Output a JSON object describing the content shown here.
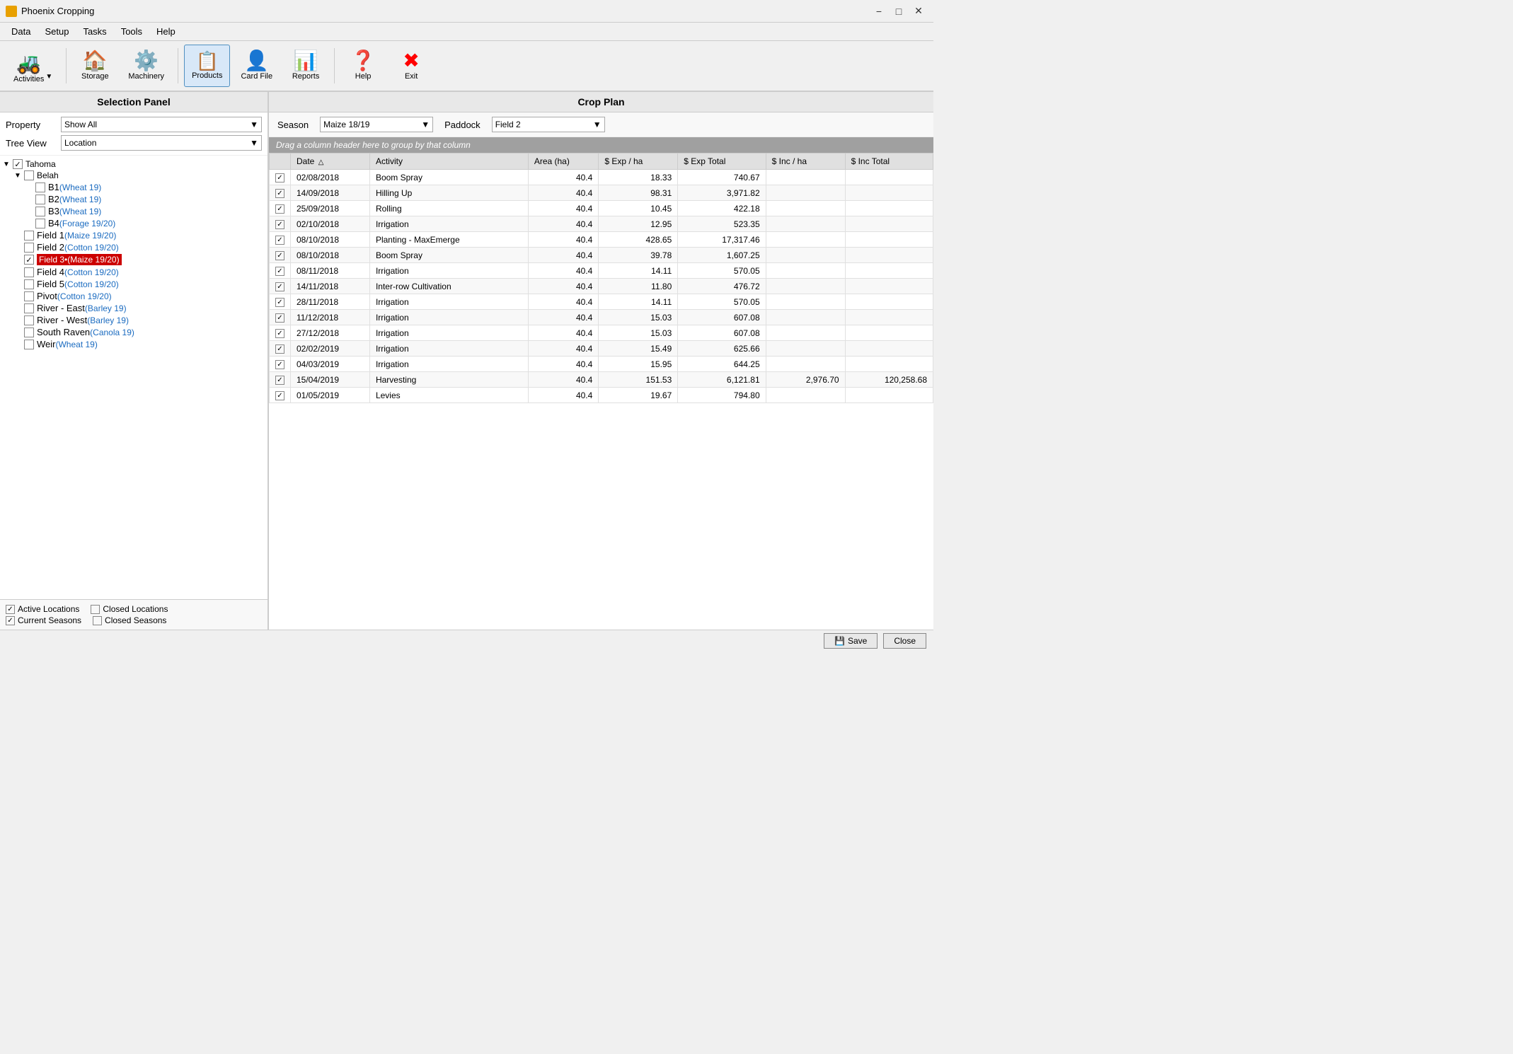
{
  "titleBar": {
    "title": "Phoenix Cropping",
    "icon": "🌾",
    "minimize": "−",
    "maximize": "□",
    "close": "✕"
  },
  "menuBar": {
    "items": [
      "Data",
      "Setup",
      "Tasks",
      "Tools",
      "Help"
    ]
  },
  "toolbar": {
    "buttons": [
      {
        "id": "activities",
        "icon": "🚜",
        "label": "Activities",
        "active": false,
        "hasArrow": true
      },
      {
        "id": "storage",
        "icon": "🏠",
        "label": "Storage",
        "active": false,
        "hasArrow": false
      },
      {
        "id": "machinery",
        "icon": "⚙️",
        "label": "Machinery",
        "active": false,
        "hasArrow": false
      },
      {
        "id": "products",
        "icon": "📋",
        "label": "Products",
        "active": true,
        "hasArrow": false
      },
      {
        "id": "cardfile",
        "icon": "👤",
        "label": "Card File",
        "active": false,
        "hasArrow": false
      },
      {
        "id": "reports",
        "icon": "📊",
        "label": "Reports",
        "active": false,
        "hasArrow": false
      },
      {
        "id": "help",
        "icon": "❓",
        "label": "Help",
        "active": false,
        "hasArrow": false
      },
      {
        "id": "exit",
        "icon": "✖",
        "label": "Exit",
        "active": false,
        "hasArrow": false,
        "iconColor": "red"
      }
    ]
  },
  "leftPanel": {
    "header": "Selection Panel",
    "propertyLabel": "Property",
    "propertyValue": "Show All",
    "treeViewLabel": "Tree View",
    "treeViewValue": "Location",
    "tree": [
      {
        "indent": 0,
        "expand": "▼",
        "checked": true,
        "label": "Tahoma",
        "blue": false,
        "highlight": false
      },
      {
        "indent": 1,
        "expand": "▼",
        "checked": false,
        "label": "Belah",
        "blue": false,
        "highlight": false
      },
      {
        "indent": 2,
        "expand": "",
        "checked": false,
        "label": "B1",
        "labelSuffix": "(Wheat 19)",
        "blue": true,
        "highlight": false
      },
      {
        "indent": 2,
        "expand": "",
        "checked": false,
        "label": "B2",
        "labelSuffix": "(Wheat 19)",
        "blue": true,
        "highlight": false
      },
      {
        "indent": 2,
        "expand": "",
        "checked": false,
        "label": "B3",
        "labelSuffix": "(Wheat 19)",
        "blue": true,
        "highlight": false
      },
      {
        "indent": 2,
        "expand": "",
        "checked": false,
        "label": "B4",
        "labelSuffix": "(Forage 19/20)",
        "blue": true,
        "highlight": false
      },
      {
        "indent": 1,
        "expand": "",
        "checked": false,
        "label": "Field 1",
        "labelSuffix": "(Maize 19/20)",
        "blue": true,
        "highlight": false
      },
      {
        "indent": 1,
        "expand": "",
        "checked": false,
        "label": "Field 2",
        "labelSuffix": "(Cotton 19/20)",
        "blue": true,
        "highlight": false
      },
      {
        "indent": 1,
        "expand": "",
        "checked": true,
        "label": "Field 3•",
        "labelSuffix": "(Maize 19/20)",
        "blue": false,
        "highlight": true
      },
      {
        "indent": 1,
        "expand": "",
        "checked": false,
        "label": "Field 4",
        "labelSuffix": "(Cotton 19/20)",
        "blue": true,
        "highlight": false
      },
      {
        "indent": 1,
        "expand": "",
        "checked": false,
        "label": "Field 5",
        "labelSuffix": "(Cotton 19/20)",
        "blue": true,
        "highlight": false
      },
      {
        "indent": 1,
        "expand": "",
        "checked": false,
        "label": "Pivot",
        "labelSuffix": "(Cotton 19/20)",
        "blue": true,
        "highlight": false
      },
      {
        "indent": 1,
        "expand": "",
        "checked": false,
        "label": "River - East",
        "labelSuffix": "(Barley 19)",
        "blue": true,
        "highlight": false
      },
      {
        "indent": 1,
        "expand": "",
        "checked": false,
        "label": "River - West",
        "labelSuffix": "(Barley 19)",
        "blue": true,
        "highlight": false
      },
      {
        "indent": 1,
        "expand": "",
        "checked": false,
        "label": "South Raven",
        "labelSuffix": "(Canola 19)",
        "blue": true,
        "highlight": false
      },
      {
        "indent": 1,
        "expand": "",
        "checked": false,
        "label": "Weir",
        "labelSuffix": "(Wheat 19)",
        "blue": true,
        "highlight": false
      }
    ],
    "bottomChecks": [
      {
        "id": "active-locations",
        "label": "Active Locations",
        "checked": true
      },
      {
        "id": "closed-locations",
        "label": "Closed Locations",
        "checked": false
      },
      {
        "id": "current-seasons",
        "label": "Current Seasons",
        "checked": true
      },
      {
        "id": "closed-seasons",
        "label": "Closed Seasons",
        "checked": false
      }
    ]
  },
  "rightPanel": {
    "header": "Crop Plan",
    "seasonLabel": "Season",
    "seasonValue": "Maize 18/19",
    "paddockLabel": "Paddock",
    "paddockValue": "Field 2",
    "groupBarText": "Drag a column header here to group by that column",
    "tableHeaders": [
      {
        "id": "check",
        "label": "",
        "sortable": false
      },
      {
        "id": "date",
        "label": "Date",
        "sortable": true,
        "sorted": true
      },
      {
        "id": "activity",
        "label": "Activity",
        "sortable": true
      },
      {
        "id": "area",
        "label": "Area (ha)",
        "sortable": true
      },
      {
        "id": "exp-ha",
        "label": "$ Exp / ha",
        "sortable": true
      },
      {
        "id": "exp-total",
        "label": "$ Exp Total",
        "sortable": true
      },
      {
        "id": "inc-ha",
        "label": "$ Inc / ha",
        "sortable": true
      },
      {
        "id": "inc-total",
        "label": "$ Inc Total",
        "sortable": true
      }
    ],
    "rows": [
      {
        "checked": true,
        "date": "02/08/2018",
        "activity": "Boom Spray",
        "area": "40.4",
        "expHa": "18.33",
        "expTotal": "740.67",
        "incHa": "",
        "incTotal": ""
      },
      {
        "checked": true,
        "date": "14/09/2018",
        "activity": "Hilling Up",
        "area": "40.4",
        "expHa": "98.31",
        "expTotal": "3,971.82",
        "incHa": "",
        "incTotal": ""
      },
      {
        "checked": true,
        "date": "25/09/2018",
        "activity": "Rolling",
        "area": "40.4",
        "expHa": "10.45",
        "expTotal": "422.18",
        "incHa": "",
        "incTotal": ""
      },
      {
        "checked": true,
        "date": "02/10/2018",
        "activity": "Irrigation",
        "area": "40.4",
        "expHa": "12.95",
        "expTotal": "523.35",
        "incHa": "",
        "incTotal": ""
      },
      {
        "checked": true,
        "date": "08/10/2018",
        "activity": "Planting - MaxEmerge",
        "area": "40.4",
        "expHa": "428.65",
        "expTotal": "17,317.46",
        "incHa": "",
        "incTotal": ""
      },
      {
        "checked": true,
        "date": "08/10/2018",
        "activity": "Boom Spray",
        "area": "40.4",
        "expHa": "39.78",
        "expTotal": "1,607.25",
        "incHa": "",
        "incTotal": ""
      },
      {
        "checked": true,
        "date": "08/11/2018",
        "activity": "Irrigation",
        "area": "40.4",
        "expHa": "14.11",
        "expTotal": "570.05",
        "incHa": "",
        "incTotal": ""
      },
      {
        "checked": true,
        "date": "14/11/2018",
        "activity": "Inter-row Cultivation",
        "area": "40.4",
        "expHa": "11.80",
        "expTotal": "476.72",
        "incHa": "",
        "incTotal": ""
      },
      {
        "checked": true,
        "date": "28/11/2018",
        "activity": "Irrigation",
        "area": "40.4",
        "expHa": "14.11",
        "expTotal": "570.05",
        "incHa": "",
        "incTotal": ""
      },
      {
        "checked": true,
        "date": "11/12/2018",
        "activity": "Irrigation",
        "area": "40.4",
        "expHa": "15.03",
        "expTotal": "607.08",
        "incHa": "",
        "incTotal": ""
      },
      {
        "checked": true,
        "date": "27/12/2018",
        "activity": "Irrigation",
        "area": "40.4",
        "expHa": "15.03",
        "expTotal": "607.08",
        "incHa": "",
        "incTotal": ""
      },
      {
        "checked": true,
        "date": "02/02/2019",
        "activity": "Irrigation",
        "area": "40.4",
        "expHa": "15.49",
        "expTotal": "625.66",
        "incHa": "",
        "incTotal": ""
      },
      {
        "checked": true,
        "date": "04/03/2019",
        "activity": "Irrigation",
        "area": "40.4",
        "expHa": "15.95",
        "expTotal": "644.25",
        "incHa": "",
        "incTotal": ""
      },
      {
        "checked": true,
        "date": "15/04/2019",
        "activity": "Harvesting",
        "area": "40.4",
        "expHa": "151.53",
        "expTotal": "6,121.81",
        "incHa": "2,976.70",
        "incTotal": "120,258.68"
      },
      {
        "checked": true,
        "date": "01/05/2019",
        "activity": "Levies",
        "area": "40.4",
        "expHa": "19.67",
        "expTotal": "794.80",
        "incHa": "",
        "incTotal": ""
      }
    ]
  },
  "statusBar": {
    "saveLabel": "Save",
    "saveIcon": "💾",
    "closeLabel": "Close"
  }
}
